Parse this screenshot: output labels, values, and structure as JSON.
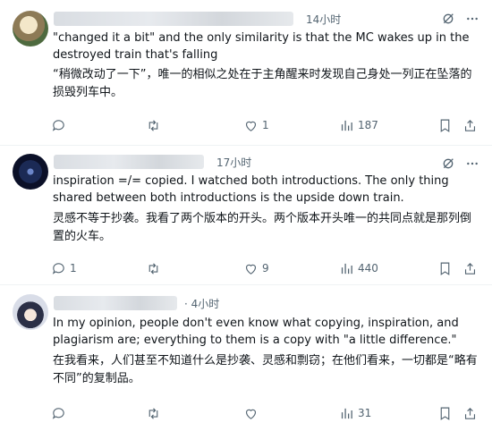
{
  "posts": [
    {
      "time": "14小时",
      "text_en": "\"changed it a bit\" and the only similarity is that the MC wakes up in the destroyed train that's falling",
      "text_zh": "“稍微改动了一下”，唯一的相似之处在于主角醒来时发现自己身处一列正在坠落的损毁列车中。",
      "reply_count": "",
      "retweet_count": "",
      "like_count": "1",
      "view_count": "187"
    },
    {
      "time": "17小时",
      "text_en": "inspiration =/= copied. I watched both introductions. The only thing shared between both introductions is the upside down train.",
      "text_zh": "灵感不等于抄袭。我看了两个版本的开头。两个版本开头唯一的共同点就是那列倒置的火车。",
      "reply_count": "1",
      "retweet_count": "",
      "like_count": "9",
      "view_count": "440"
    },
    {
      "time": "· 4小时",
      "text_en": "In my opinion, people don't even know what copying, inspiration, and plagiarism are; everything to them is a copy with \"a little difference.\"",
      "text_zh": "在我看来，人们甚至不知道什么是抄袭、灵感和剽窃；在他们看来，一切都是“略有不同”的复制品。",
      "reply_count": "",
      "retweet_count": "",
      "like_count": "",
      "view_count": "31"
    }
  ],
  "icons": {
    "grok": "grok-icon",
    "more": "more-icon",
    "reply": "reply-icon",
    "retweet": "retweet-icon",
    "like": "like-icon",
    "views": "views-icon",
    "bookmark": "bookmark-icon",
    "share": "share-icon"
  },
  "colors": {
    "text": "#0f1419",
    "secondary": "#536471",
    "divider": "#eff3f4"
  }
}
